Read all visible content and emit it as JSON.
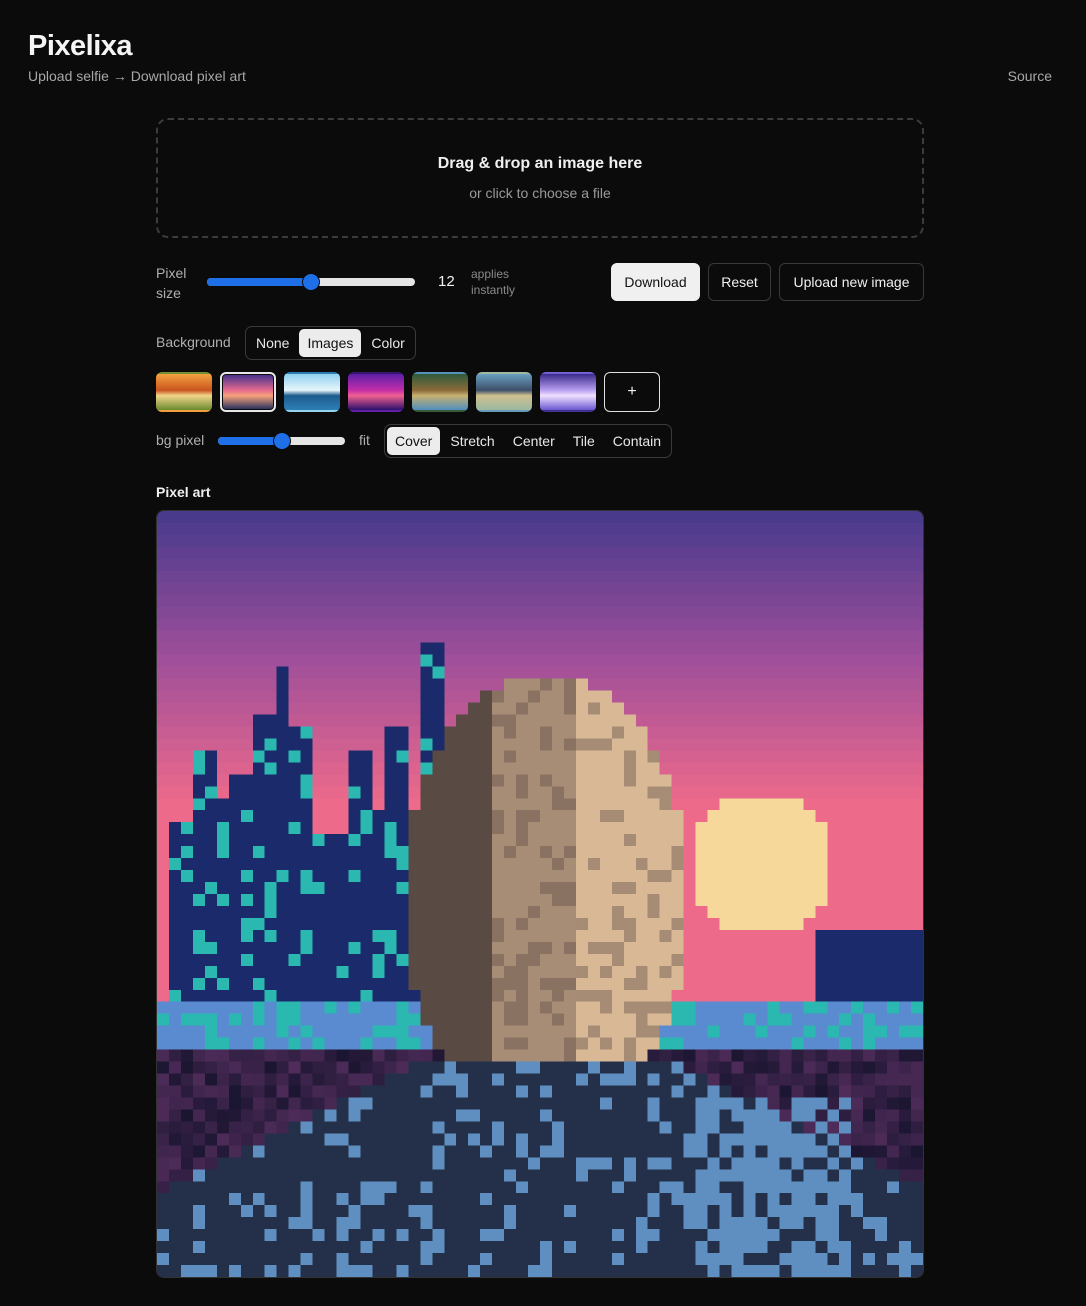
{
  "header": {
    "title": "Pixelixa",
    "subtitle": "Upload selfie → Download pixel art",
    "source_link": "Source"
  },
  "dropzone": {
    "title": "Drag & drop an image here",
    "subtitle": "or click to choose a file"
  },
  "controls": {
    "pixel_size_label": "Pixel size",
    "pixel_size_value": "12",
    "pixel_size_fraction": 0.5,
    "pixel_size_hint": "applies instantly",
    "download_label": "Download",
    "reset_label": "Reset",
    "upload_new_label": "Upload new image",
    "background_label": "Background",
    "background_options": [
      "None",
      "Images",
      "Color"
    ],
    "background_selected": "Images",
    "bg_pixel_label": "bg pixel",
    "bg_pixel_fraction": 0.5,
    "fit_label": "fit",
    "fit_options": [
      "Cover",
      "Stretch",
      "Center",
      "Tile",
      "Contain"
    ],
    "fit_selected": "Cover",
    "add_thumbnail_label": "+"
  },
  "thumbnails": [
    {
      "name": "autumn-park",
      "colors": [
        "#f4a340",
        "#c9551f",
        "#6a8a2e",
        "#f1d58a"
      ],
      "selected": false
    },
    {
      "name": "city-sunset",
      "colors": [
        "#3b2f8a",
        "#e66b8f",
        "#1b2a5c",
        "#f7a27a"
      ],
      "selected": true
    },
    {
      "name": "ocean-clouds",
      "colors": [
        "#8fd0ef",
        "#e8f6fb",
        "#2d7fb6",
        "#1d5c8c"
      ],
      "selected": false
    },
    {
      "name": "purple-night",
      "colors": [
        "#5b1fa8",
        "#c42ea8",
        "#2a0f6b",
        "#f06090"
      ],
      "selected": false
    },
    {
      "name": "forest-town",
      "colors": [
        "#2f5a3a",
        "#8a6a3a",
        "#4f8fbf",
        "#c8b070"
      ],
      "selected": false
    },
    {
      "name": "city-street",
      "colors": [
        "#6aa0c0",
        "#3c4f6a",
        "#9ab8a0",
        "#d0c090"
      ],
      "selected": false
    },
    {
      "name": "lavender-night",
      "colors": [
        "#3a2a8a",
        "#b8a0f0",
        "#6a58d0",
        "#f0e0ff"
      ],
      "selected": false
    }
  ],
  "output": {
    "label": "Pixel art",
    "palette": {
      "sky_top": "#4a3a8c",
      "sky_mid": "#a04f9a",
      "sky_low": "#ee6a8a",
      "sun": "#f6d99a",
      "city_dark": "#1a2a6a",
      "city_teal": "#2bb8b0",
      "water": "#5a8ad0",
      "skin_light": "#d9b896",
      "skin_mid": "#a88d76",
      "skin_dark": "#5a4a44",
      "shirt": "#243049",
      "shirt_light": "#5f8ec0",
      "ground": "#1a1530"
    }
  }
}
